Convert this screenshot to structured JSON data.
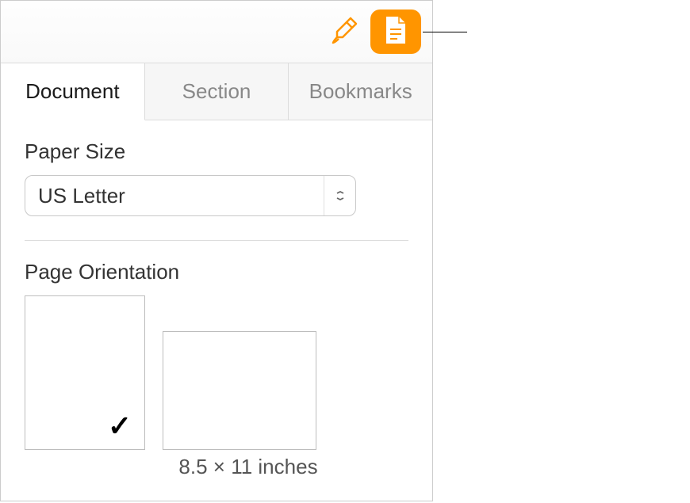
{
  "toolbar": {
    "format_icon": "format-brush-icon",
    "document_icon": "document-icon"
  },
  "tabs": {
    "items": [
      {
        "label": "Document",
        "active": true
      },
      {
        "label": "Section",
        "active": false
      },
      {
        "label": "Bookmarks",
        "active": false
      }
    ]
  },
  "paper_size": {
    "label": "Paper Size",
    "value": "US Letter"
  },
  "orientation": {
    "label": "Page Orientation",
    "selected": "portrait",
    "dimensions": "8.5 × 11 inches"
  },
  "colors": {
    "accent": "#ff9500"
  }
}
